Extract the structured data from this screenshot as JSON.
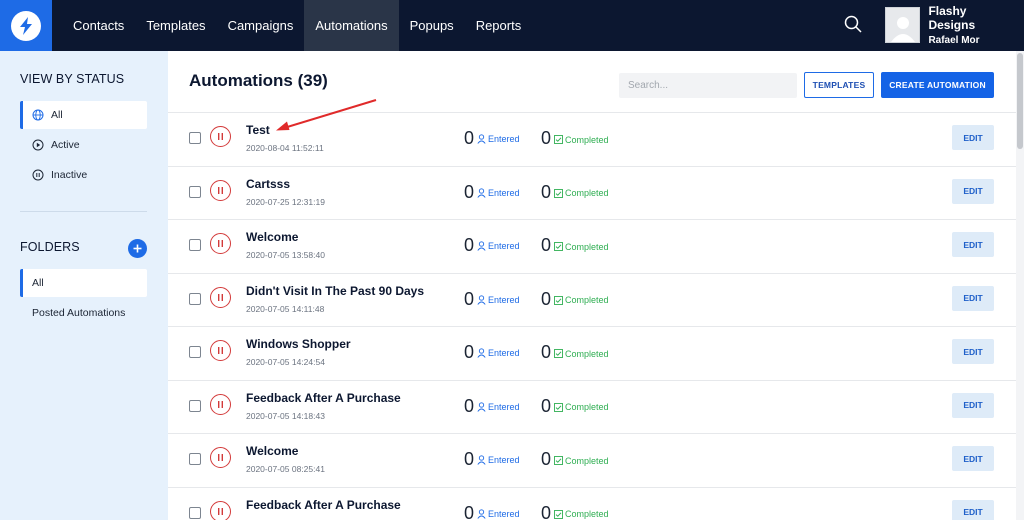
{
  "nav": {
    "items": [
      {
        "label": "Contacts",
        "active": false
      },
      {
        "label": "Templates",
        "active": false
      },
      {
        "label": "Campaigns",
        "active": false
      },
      {
        "label": "Automations",
        "active": true
      },
      {
        "label": "Popups",
        "active": false
      },
      {
        "label": "Reports",
        "active": false
      }
    ],
    "account": {
      "company": "Flashy Designs",
      "user": "Rafael Mor"
    }
  },
  "sidebar": {
    "status_heading": "VIEW BY STATUS",
    "status_items": [
      {
        "label": "All",
        "icon": "globe-icon",
        "active": true
      },
      {
        "label": "Active",
        "icon": "play-circle-icon",
        "active": false
      },
      {
        "label": "Inactive",
        "icon": "pause-circle-icon",
        "active": false
      }
    ],
    "folders_heading": "FOLDERS",
    "folder_items": [
      {
        "label": "All",
        "active": true
      },
      {
        "label": "Posted Automations",
        "active": false
      }
    ]
  },
  "main": {
    "title": "Automations (39)",
    "search": {
      "placeholder": "Search...",
      "value": ""
    },
    "templates_button": "TEMPLATES",
    "create_button": "CREATE AUTOMATION",
    "entered_label": "Entered",
    "completed_label": "Completed",
    "edit_label": "EDIT",
    "rows": [
      {
        "name": "Test",
        "date": "2020-08-04 11:52:11",
        "entered": "0",
        "completed": "0"
      },
      {
        "name": "Cartsss",
        "date": "2020-07-25 12:31:19",
        "entered": "0",
        "completed": "0"
      },
      {
        "name": "Welcome",
        "date": "2020-07-05 13:58:40",
        "entered": "0",
        "completed": "0"
      },
      {
        "name": "Didn't Visit In The Past 90 Days",
        "date": "2020-07-05 14:11:48",
        "entered": "0",
        "completed": "0"
      },
      {
        "name": "Windows Shopper",
        "date": "2020-07-05 14:24:54",
        "entered": "0",
        "completed": "0"
      },
      {
        "name": "Feedback After A Purchase",
        "date": "2020-07-05 14:18:43",
        "entered": "0",
        "completed": "0"
      },
      {
        "name": "Welcome",
        "date": "2020-07-05 08:25:41",
        "entered": "0",
        "completed": "0"
      },
      {
        "name": "Feedback After A Purchase",
        "date": "",
        "entered": "0",
        "completed": "0"
      }
    ]
  },
  "colors": {
    "nav_bg": "#0c1730",
    "accent": "#1e6be6",
    "pause": "#d33a3a",
    "completed": "#2fae52",
    "annotation_arrow": "#e02a2a"
  }
}
